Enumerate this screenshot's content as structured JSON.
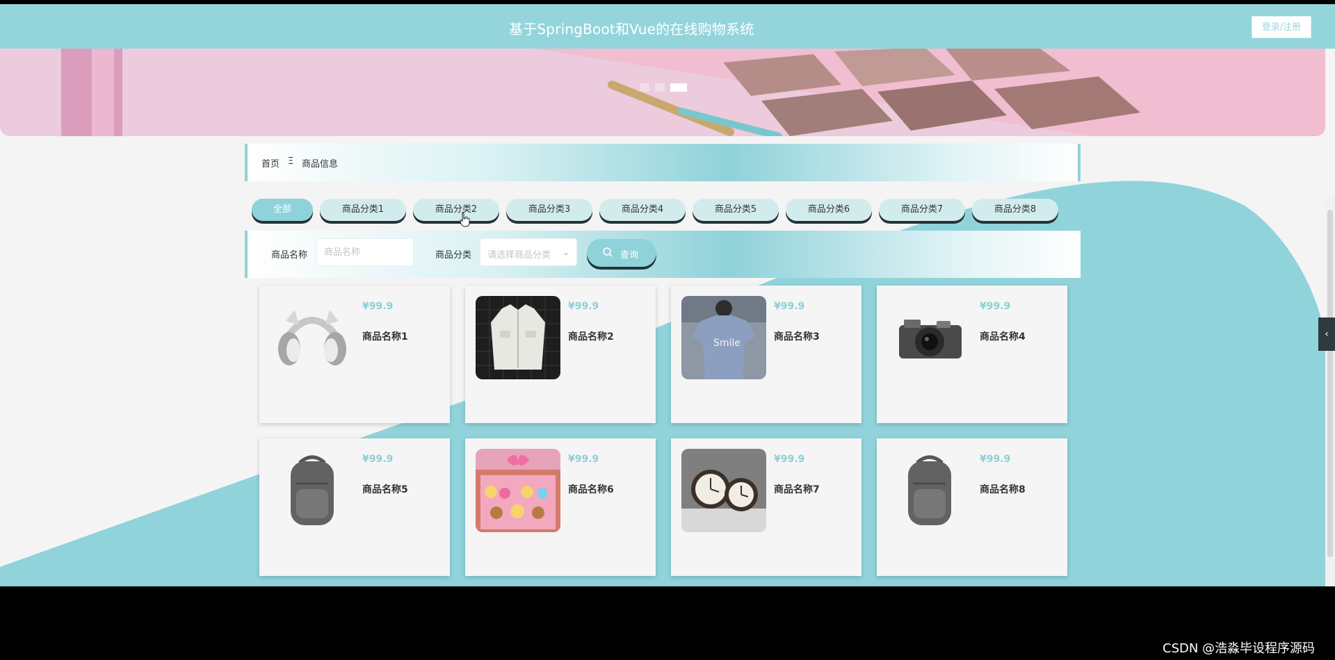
{
  "header": {
    "title": "基于SpringBoot和Vue的在线购物系统",
    "login_label": "登录/注册"
  },
  "breadcrumb": {
    "home": "首页",
    "separator": "Ξ",
    "current": "商品信息"
  },
  "categories": [
    "全部",
    "商品分类1",
    "商品分类2",
    "商品分类3",
    "商品分类4",
    "商品分类5",
    "商品分类6",
    "商品分类7",
    "商品分类8"
  ],
  "search": {
    "name_label": "商品名称",
    "name_placeholder": "商品名称",
    "category_label": "商品分类",
    "category_placeholder": "请选择商品分类",
    "button_label": "查询"
  },
  "products": [
    {
      "price": "¥99.9",
      "name": "商品名称1",
      "icon": "headphones-image"
    },
    {
      "price": "¥99.9",
      "name": "商品名称2",
      "icon": "jacket-image"
    },
    {
      "price": "¥99.9",
      "name": "商品名称3",
      "icon": "tshirt-image"
    },
    {
      "price": "¥99.9",
      "name": "商品名称4",
      "icon": "camera-image"
    },
    {
      "price": "¥99.9",
      "name": "商品名称5",
      "icon": "backpack-image"
    },
    {
      "price": "¥99.9",
      "name": "商品名称6",
      "icon": "gift-box-image"
    },
    {
      "price": "¥99.9",
      "name": "商品名称7",
      "icon": "clock-image"
    },
    {
      "price": "¥99.9",
      "name": "商品名称8",
      "icon": "backpack-image"
    }
  ],
  "watermark": "CSDN @浩淼毕设程序源码",
  "colors": {
    "accent": "#8fd2d9",
    "header": "#94d5dc",
    "wave": "#90d3db",
    "shadow": "#263238"
  }
}
